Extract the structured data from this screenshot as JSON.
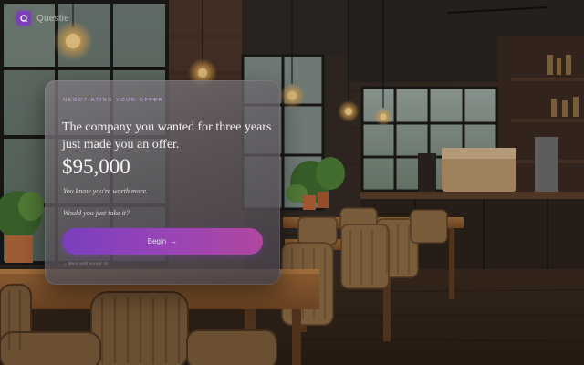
{
  "brand": {
    "name": "Questie",
    "icon": "logo-mark-icon",
    "accent": "#7b3fb8"
  },
  "card": {
    "eyebrow": "NEGOTIATING YOUR OFFER",
    "headline": "The company you wanted for three years just made you an offer.",
    "amount": "$95,000",
    "note": "You know you're worth more.",
    "question": "Would you just take it?",
    "begin_label": "Begin",
    "begin_arrow": "→",
    "footnote": "→ Best with sound on",
    "button_gradient": [
      "#7a3fbe",
      "#b0479f"
    ]
  }
}
